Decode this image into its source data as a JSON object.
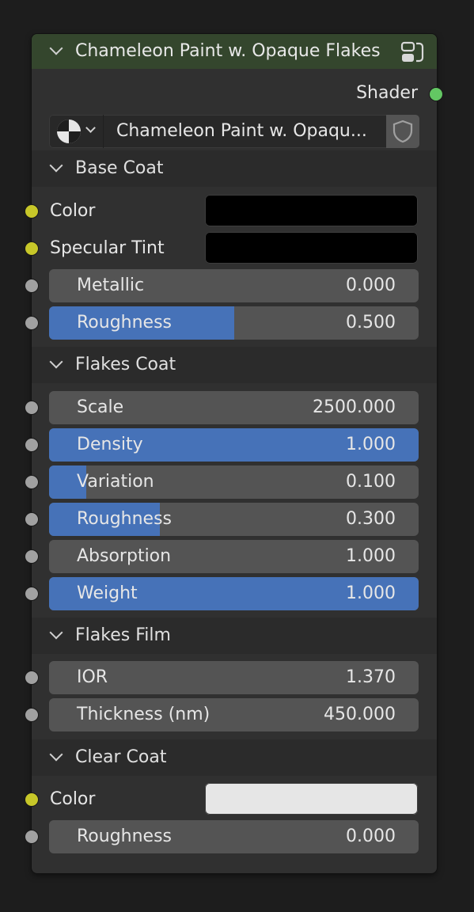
{
  "node": {
    "title": "Chameleon Paint w. Opaque Flakes",
    "output_label": "Shader",
    "group_name": "Chameleon Paint w. Opaqu...",
    "header_color": "#34462d"
  },
  "panels": {
    "base_coat": {
      "title": "Base Coat",
      "color_label": "Color",
      "color_value": "#000000",
      "specular_tint_label": "Specular Tint",
      "specular_tint_value": "#000000",
      "metallic": {
        "label": "Metallic",
        "value": "0.000",
        "fraction": 0.0
      },
      "roughness": {
        "label": "Roughness",
        "value": "0.500",
        "fraction": 0.5
      }
    },
    "flakes_coat": {
      "title": "Flakes Coat",
      "scale": {
        "label": "Scale",
        "value": "2500.000"
      },
      "density": {
        "label": "Density",
        "value": "1.000",
        "fraction": 1.0
      },
      "variation": {
        "label": "Variation",
        "value": "0.100",
        "fraction": 0.1
      },
      "roughness": {
        "label": "Roughness",
        "value": "0.300",
        "fraction": 0.3
      },
      "absorption": {
        "label": "Absorption",
        "value": "1.000"
      },
      "weight": {
        "label": "Weight",
        "value": "1.000",
        "fraction": 1.0
      }
    },
    "flakes_film": {
      "title": "Flakes Film",
      "ior": {
        "label": "IOR",
        "value": "1.370"
      },
      "thickness": {
        "label": "Thickness (nm)",
        "value": "450.000"
      }
    },
    "clear_coat": {
      "title": "Clear Coat",
      "color_label": "Color",
      "color_value": "#e6e6e6",
      "roughness": {
        "label": "Roughness",
        "value": "0.000",
        "fraction": 0.0
      }
    }
  },
  "icons": {
    "collapse": "chevron-down-icon",
    "node_group": "node-group-icon",
    "material_browse": "material-sphere-icon",
    "fake_user": "shield-icon"
  },
  "colors": {
    "accent_fill": "#4672b8",
    "shader_socket": "#63c763",
    "color_socket": "#c7c729",
    "float_socket": "#a1a1a1"
  }
}
